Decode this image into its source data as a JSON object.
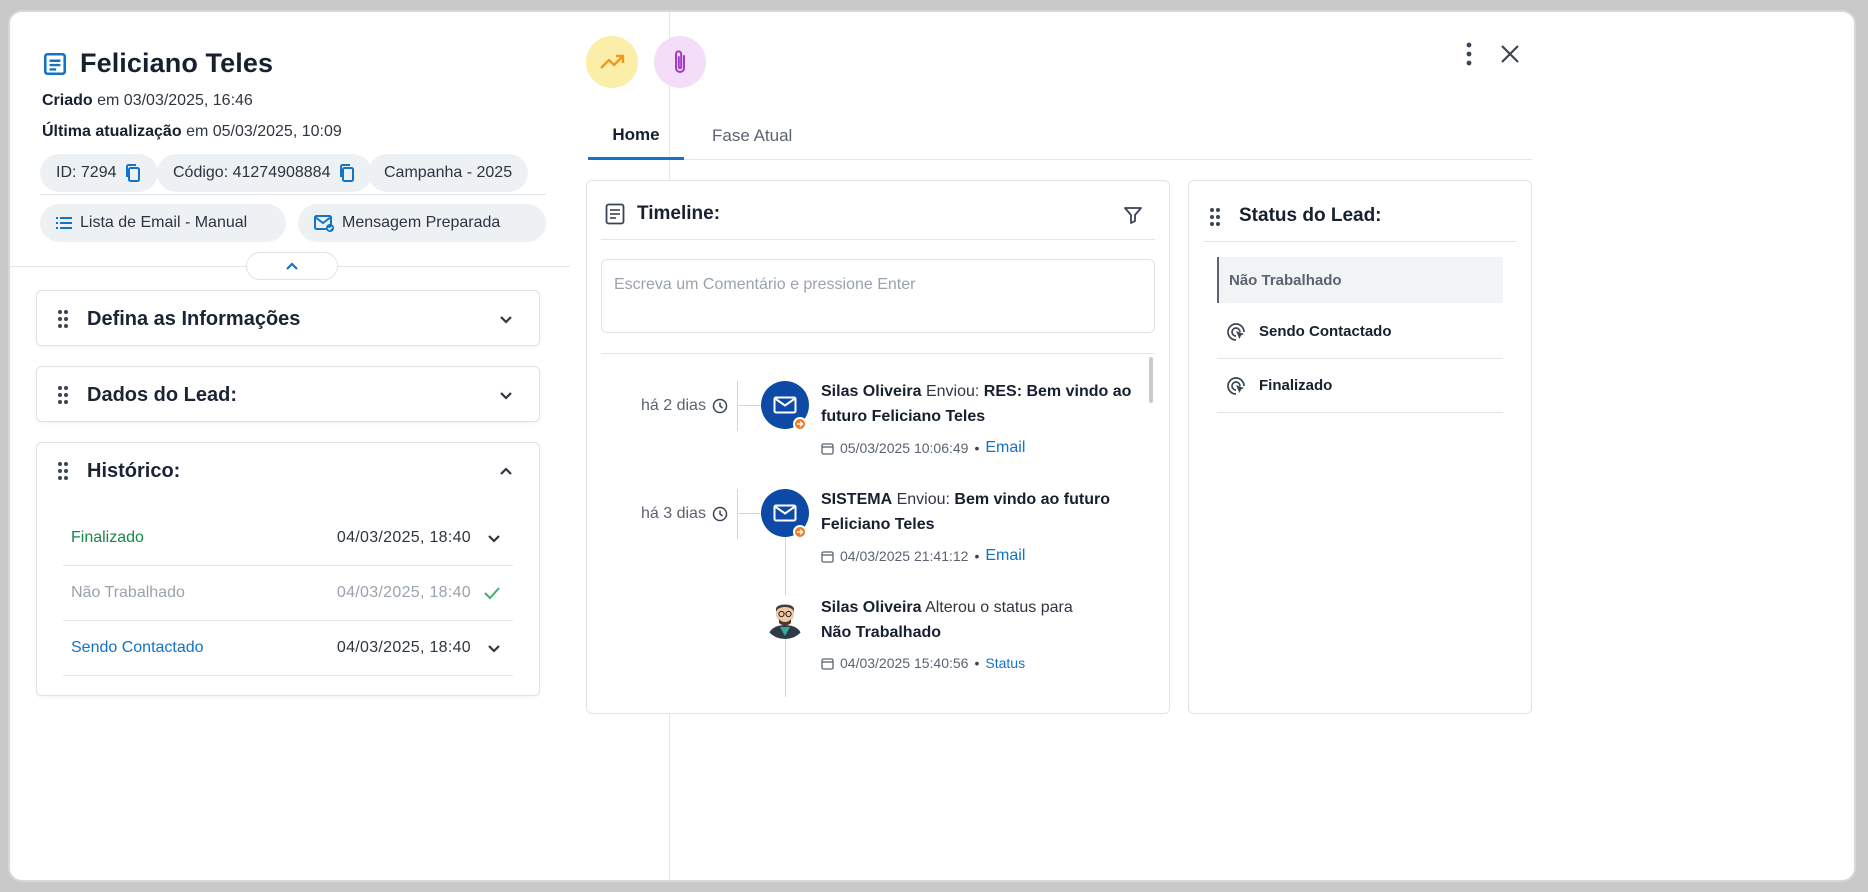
{
  "lead": {
    "title": "Feliciano Teles",
    "created_label": "Criado",
    "created_value": "em 03/03/2025, 16:46",
    "updated_label": "Última atualização",
    "updated_value": "em 05/03/2025, 10:09",
    "chips": {
      "id": "ID: 7294",
      "codigo": "Código: 41274908884",
      "campanha": "Campanha - 2025",
      "lista": "Lista de Email - Manual",
      "mensagem": "Mensagem Preparada"
    }
  },
  "cards": {
    "defina": "Defina as Informações",
    "dados": "Dados do Lead:",
    "historico": "Histórico:"
  },
  "historico": [
    {
      "name": "Finalizado",
      "date": "04/03/2025, 18:40",
      "color": "#17874a",
      "icon": "chevron-down-icon"
    },
    {
      "name": "Não Trabalhado",
      "date": "04/03/2025, 18:40",
      "color": "#9aa3ad",
      "icon": "check-icon"
    },
    {
      "name": "Sendo Contactado",
      "date": "04/03/2025, 18:40",
      "color": "#1273c8",
      "icon": "chevron-down-icon"
    }
  ],
  "toolbar": {
    "trend_icon": "trending-up-icon",
    "attach_icon": "paperclip-icon",
    "trend_color": "#fbeea9",
    "attach_color": "#f3ddf9"
  },
  "tabs": [
    "Home",
    "Fase Atual"
  ],
  "timeline": {
    "title": "Timeline:",
    "placeholder": "Escreva um Comentário e pressione Enter",
    "events": [
      {
        "time": "há 2 dias",
        "actor": "Silas Oliveira",
        "verb": "Enviou:",
        "line1_bold": "RES: Bem vindo",
        "line2_bold": "ao futuro Feliciano Teles",
        "date": "05/03/2025 10:06:49",
        "type": "Email"
      },
      {
        "time": "há 3 dias",
        "actor": "SISTEMA",
        "verb": "Enviou:",
        "line1_bold": "Bem vindo ao futuro",
        "line2_bold": "Feliciano Teles",
        "date": "04/03/2025 21:41:12",
        "type": "Email"
      },
      {
        "time": "",
        "actor": "Silas Oliveira",
        "verb": "Alterou o status para",
        "line1_bold": "",
        "line2_bold": "Não Trabalhado",
        "date": "04/03/2025 15:40:56",
        "type": "Status"
      }
    ]
  },
  "status": {
    "title": "Status do Lead:",
    "items": [
      "Não Trabalhado",
      "Sendo Contactado",
      "Finalizado"
    ]
  }
}
